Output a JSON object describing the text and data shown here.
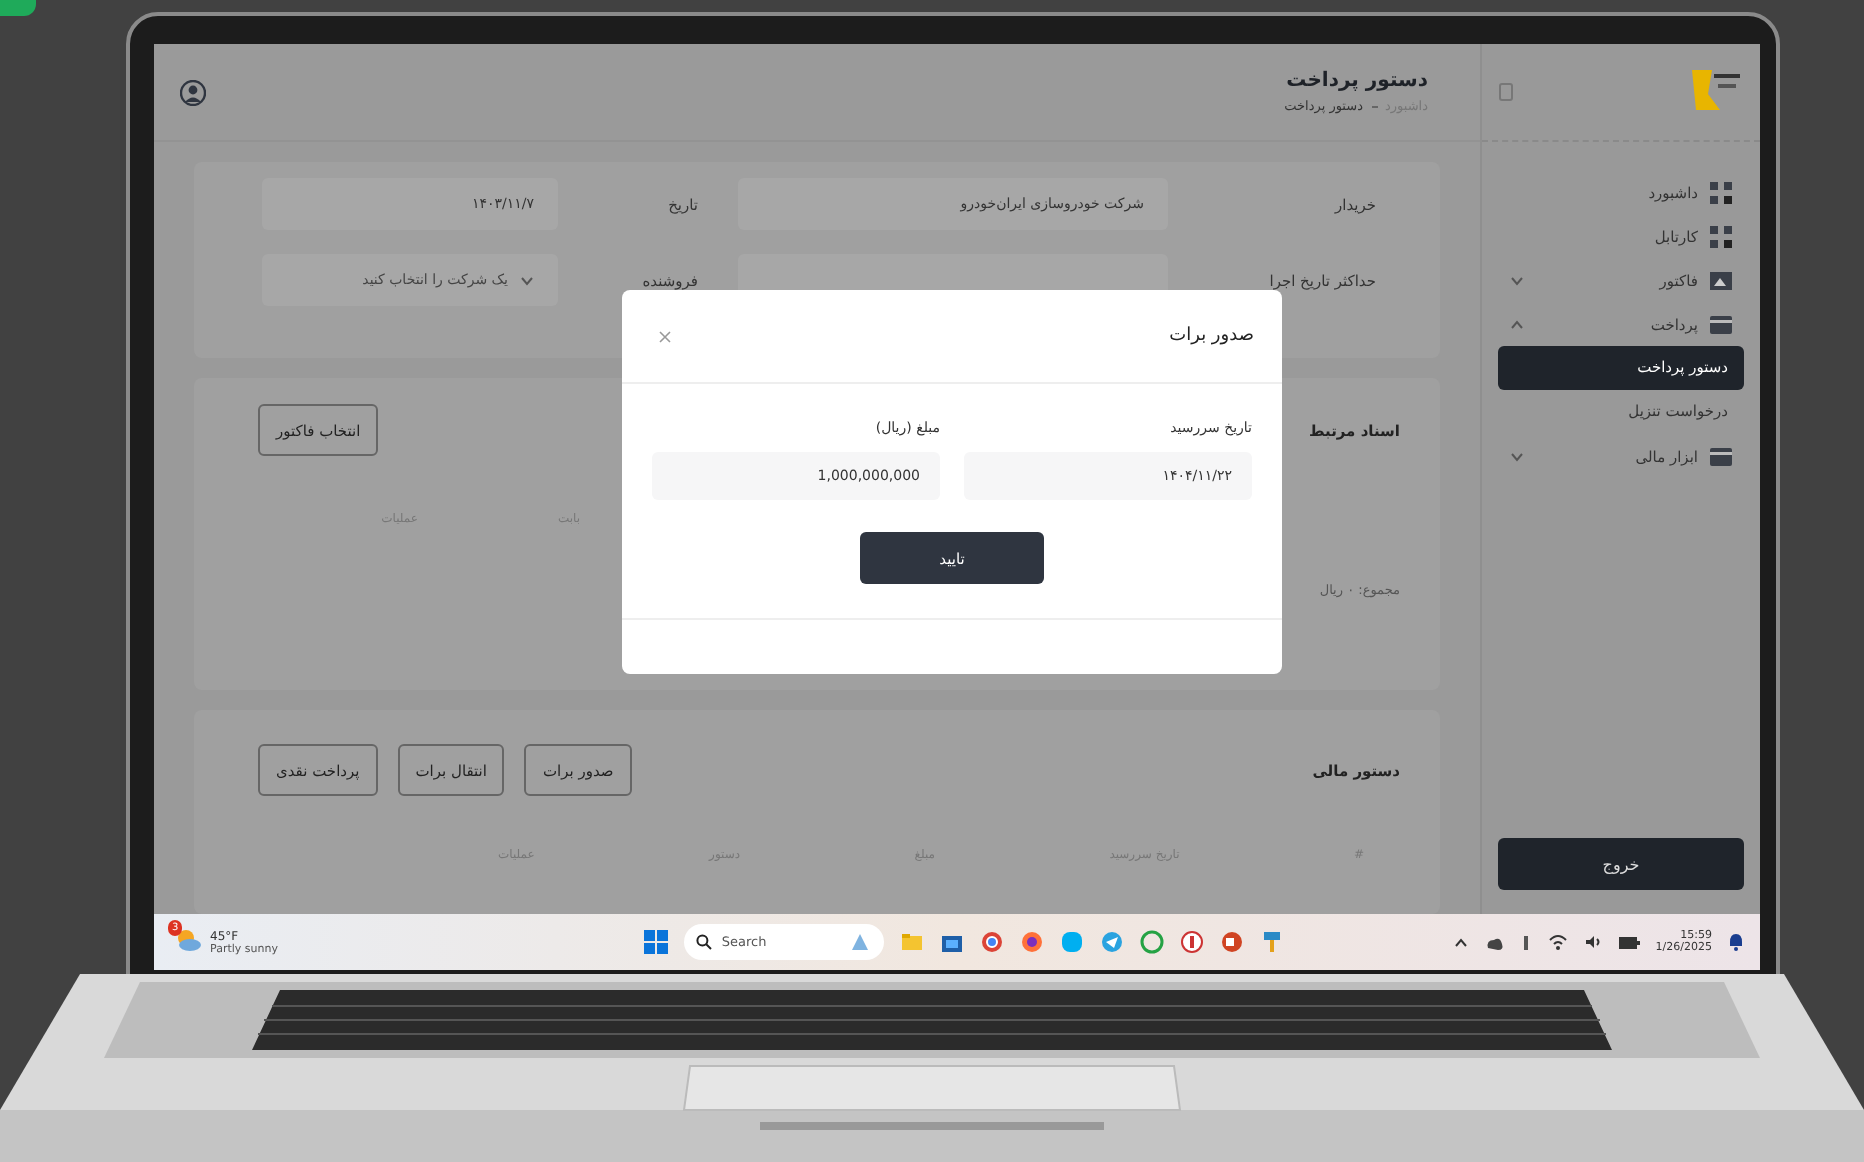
{
  "header": {
    "title": "دستور پرداخت",
    "breadcrumb": [
      {
        "label": "داشبورد",
        "selected": false
      },
      {
        "label": "دستور پرداخت",
        "selected": true
      }
    ]
  },
  "sidebar": {
    "items": [
      {
        "label": "داشبورد",
        "selected": false
      },
      {
        "label": "کارتابل",
        "selected": false
      },
      {
        "label": "فاکتور",
        "selected": false,
        "expanded": false
      },
      {
        "label": "پرداخت",
        "selected": false,
        "expanded": true,
        "children": [
          {
            "label": "دستور پرداخت",
            "selected": true
          },
          {
            "label": "درخواست تنزیل",
            "selected": false
          }
        ]
      },
      {
        "label": "ابزار مالی",
        "selected": false,
        "expanded": false
      }
    ],
    "logout": "خروج"
  },
  "form": {
    "fields": [
      {
        "label": "خریدار",
        "value": "شرکت خودروسازی ایران‌خودرو",
        "kind": "text"
      },
      {
        "label": "تاریخ",
        "value": "۱۴۰۳/۱۱/۷",
        "kind": "text"
      },
      {
        "label": "حداکثر تاریخ اجرا",
        "kind": "text"
      },
      {
        "label": "فروشنده",
        "placeholder": "یک شرکت را انتخاب کنید",
        "kind": "select"
      }
    ]
  },
  "related_docs": {
    "title": "اسناد مرتبط",
    "button": "انتخاب فاکتور",
    "columns": [
      "بابت",
      "عملیات"
    ],
    "total": "مجموع: ۰ ریال"
  },
  "financial_order": {
    "title": "دستور مالی",
    "buttons": [
      "صدور برات",
      "انتقال برات",
      "پرداخت نقدی"
    ],
    "columns": [
      "#",
      "تاریخ سررسید",
      "مبلغ",
      "دستور",
      "عملیات"
    ]
  },
  "modal": {
    "title": "صدور برات",
    "fields": [
      {
        "label": "تاریخ سررسید",
        "value": "۱۴۰۴/۱۱/۲۲"
      },
      {
        "label": "مبلغ (ریال)",
        "value": "1,000,000,000"
      }
    ],
    "button": "تایید"
  },
  "taskbar": {
    "weather": {
      "temp": "45°F",
      "desc": "Partly sunny",
      "badge": "3"
    },
    "search": {
      "placeholder": "Search"
    },
    "time": "15:59",
    "date": "1/26/2025"
  }
}
